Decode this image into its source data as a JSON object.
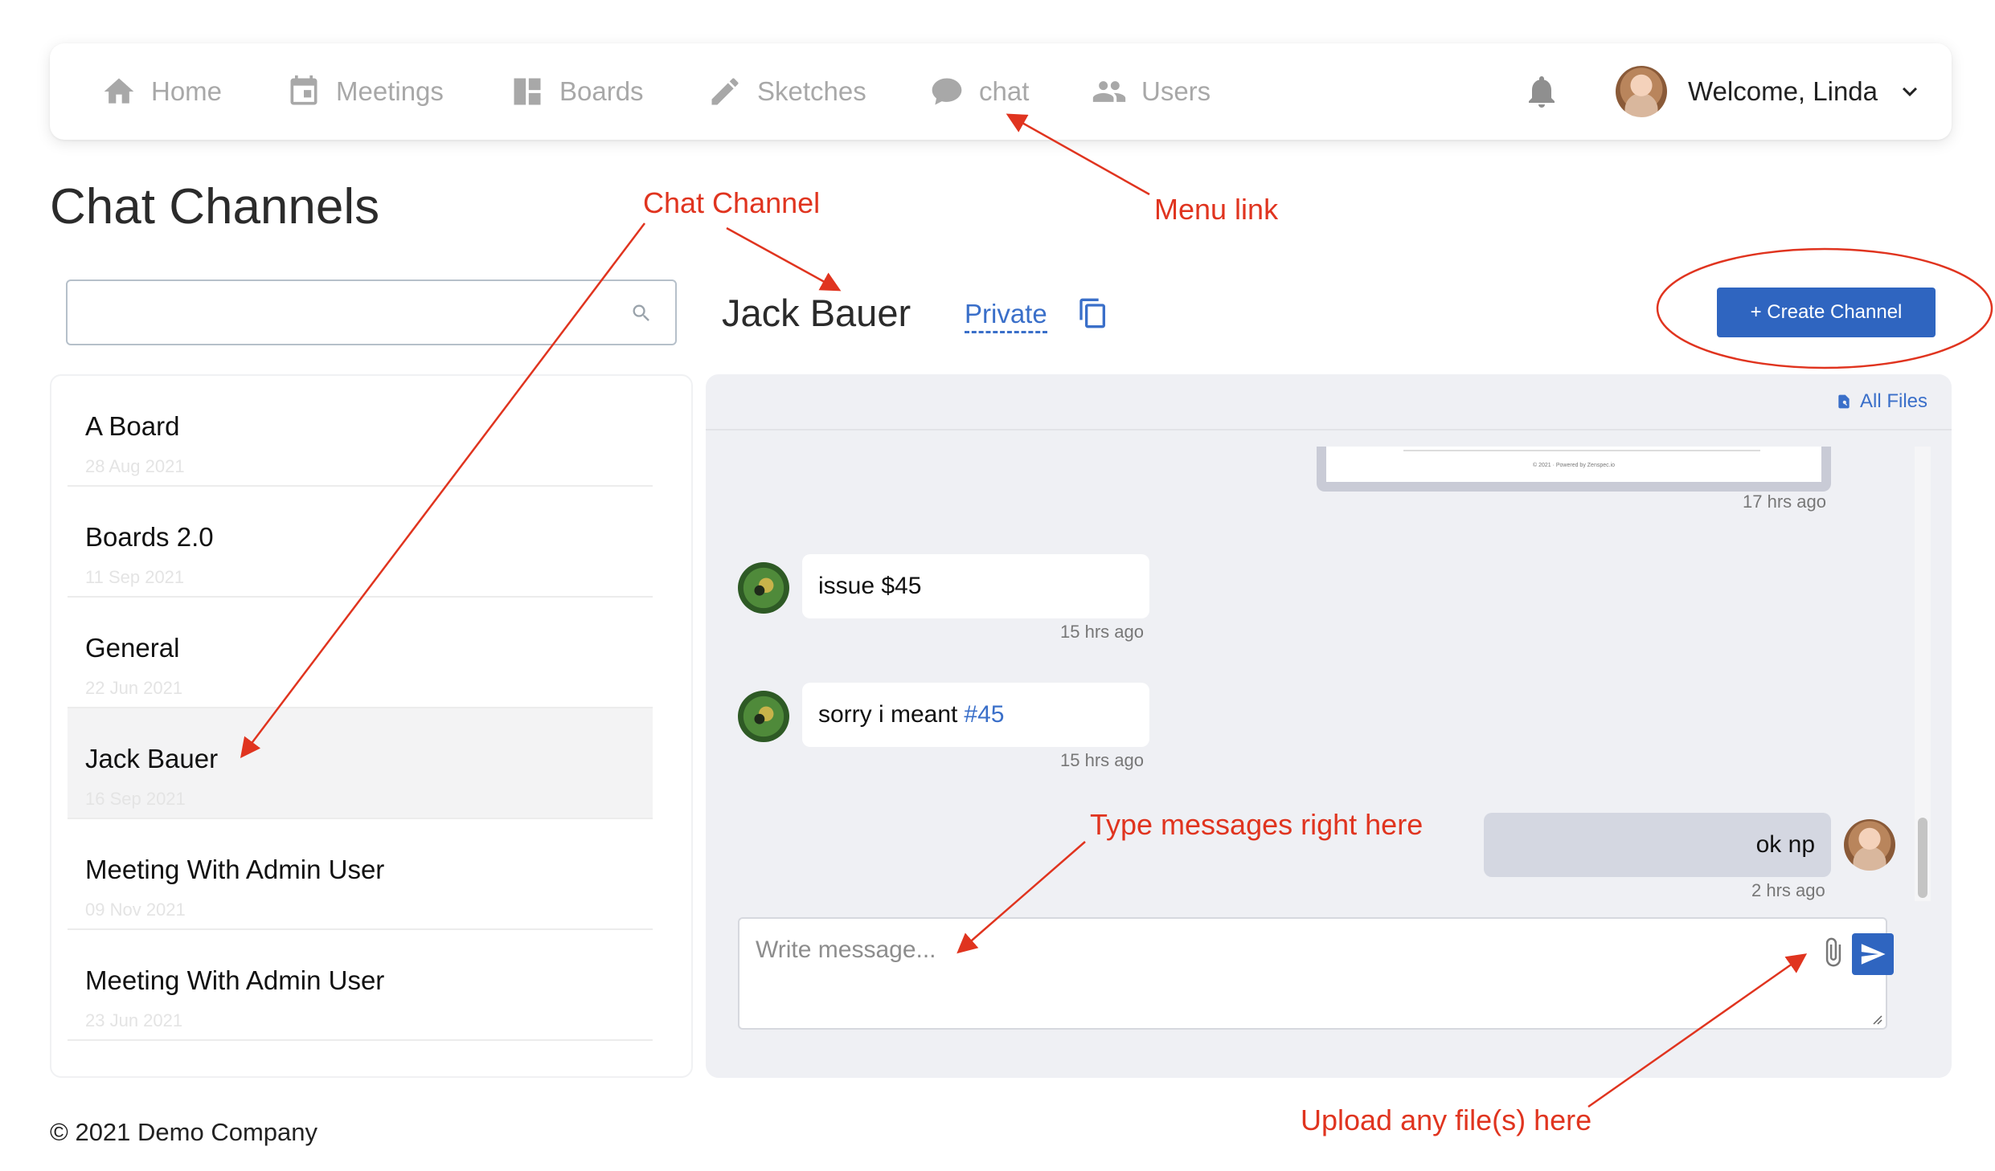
{
  "nav": {
    "items": [
      {
        "label": "Home",
        "icon": "home-icon"
      },
      {
        "label": "Meetings",
        "icon": "calendar-icon"
      },
      {
        "label": "Boards",
        "icon": "boards-icon"
      },
      {
        "label": "Sketches",
        "icon": "pencil-icon"
      },
      {
        "label": "chat",
        "icon": "chat-bubble-icon"
      },
      {
        "label": "Users",
        "icon": "users-icon"
      }
    ],
    "notifications_icon": "bell-icon",
    "welcome": "Welcome, Linda"
  },
  "page": {
    "title": "Chat Channels",
    "footer": "© 2021 Demo Company"
  },
  "search": {
    "placeholder": "",
    "value": ""
  },
  "channels": [
    {
      "name": "A Board",
      "date": "28 Aug 2021"
    },
    {
      "name": "Boards 2.0",
      "date": "11 Sep 2021"
    },
    {
      "name": "General",
      "date": "22 Jun 2021"
    },
    {
      "name": "Jack Bauer",
      "date": "16 Sep 2021",
      "active": true
    },
    {
      "name": "Meeting With Admin User",
      "date": "09 Nov 2021"
    },
    {
      "name": "Meeting With Admin User",
      "date": "23 Jun 2021"
    }
  ],
  "current_channel": {
    "title": "Jack Bauer",
    "privacy": "Private",
    "create_button": "+ Create Channel",
    "all_files": "All Files",
    "attachment_footer": "© 2021 · Powered by Zenspec.io",
    "attachment_time": "17 hrs ago",
    "messages": [
      {
        "text": "issue $45",
        "time": "15 hrs ago",
        "mine": false
      },
      {
        "text": "sorry i meant",
        "link": "#45",
        "time": "15 hrs ago",
        "mine": false
      },
      {
        "text": "ok np",
        "time": "2 hrs ago",
        "mine": true
      }
    ],
    "composer_placeholder": "Write message..."
  },
  "annotations": {
    "chat_channel": "Chat Channel",
    "menu_link": "Menu link",
    "type_messages": "Type messages right here",
    "upload_files": "Upload any file(s) here"
  },
  "colors": {
    "accent": "#2f65c0",
    "link": "#3a6fc9",
    "annotation": "#e0341f",
    "chat_bg": "#eff0f4"
  }
}
